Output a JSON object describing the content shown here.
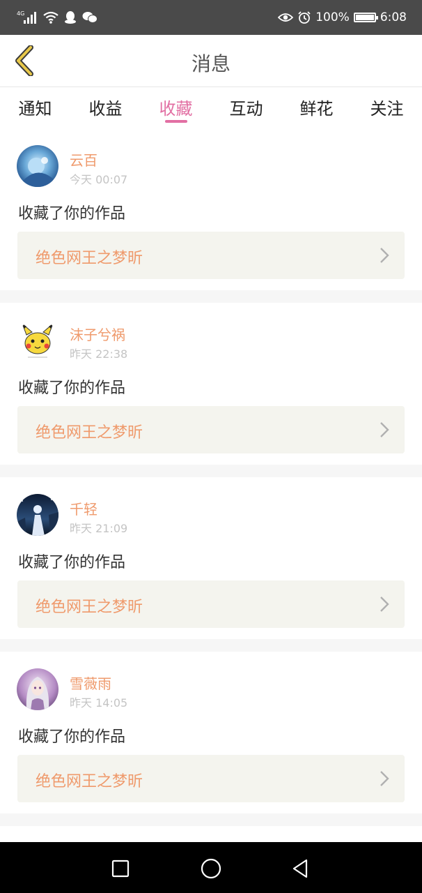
{
  "status_bar": {
    "network": "4G",
    "battery_percent_label": "100%",
    "battery_level": 1.0,
    "time": "6:08"
  },
  "header": {
    "title": "消息"
  },
  "tabs": [
    {
      "label": "通知",
      "active": false
    },
    {
      "label": "收益",
      "active": false
    },
    {
      "label": "收藏",
      "active": true
    },
    {
      "label": "互动",
      "active": false
    },
    {
      "label": "鲜花",
      "active": false
    },
    {
      "label": "关注",
      "active": false
    }
  ],
  "messages": [
    {
      "username": "云百",
      "time": "今天 00:07",
      "action": "收藏了你的作品",
      "work_title": "绝色网王之梦昕",
      "avatar_icon": "anime-blue-avatar"
    },
    {
      "username": "沫子兮祸",
      "time": "昨天 22:38",
      "action": "收藏了你的作品",
      "work_title": "绝色网王之梦昕",
      "avatar_icon": "pikachu-avatar"
    },
    {
      "username": "千轻",
      "time": "昨天 21:09",
      "action": "收藏了你的作品",
      "work_title": "绝色网王之梦昕",
      "avatar_icon": "night-scene-avatar"
    },
    {
      "username": "雪薇雨",
      "time": "昨天 14:05",
      "action": "收藏了你的作品",
      "work_title": "绝色网王之梦昕",
      "avatar_icon": "anime-girl-avatar"
    }
  ],
  "colors": {
    "accent": "#e26fa3",
    "username": "#ef9a6c",
    "back_arrow": "#e8c84a"
  }
}
